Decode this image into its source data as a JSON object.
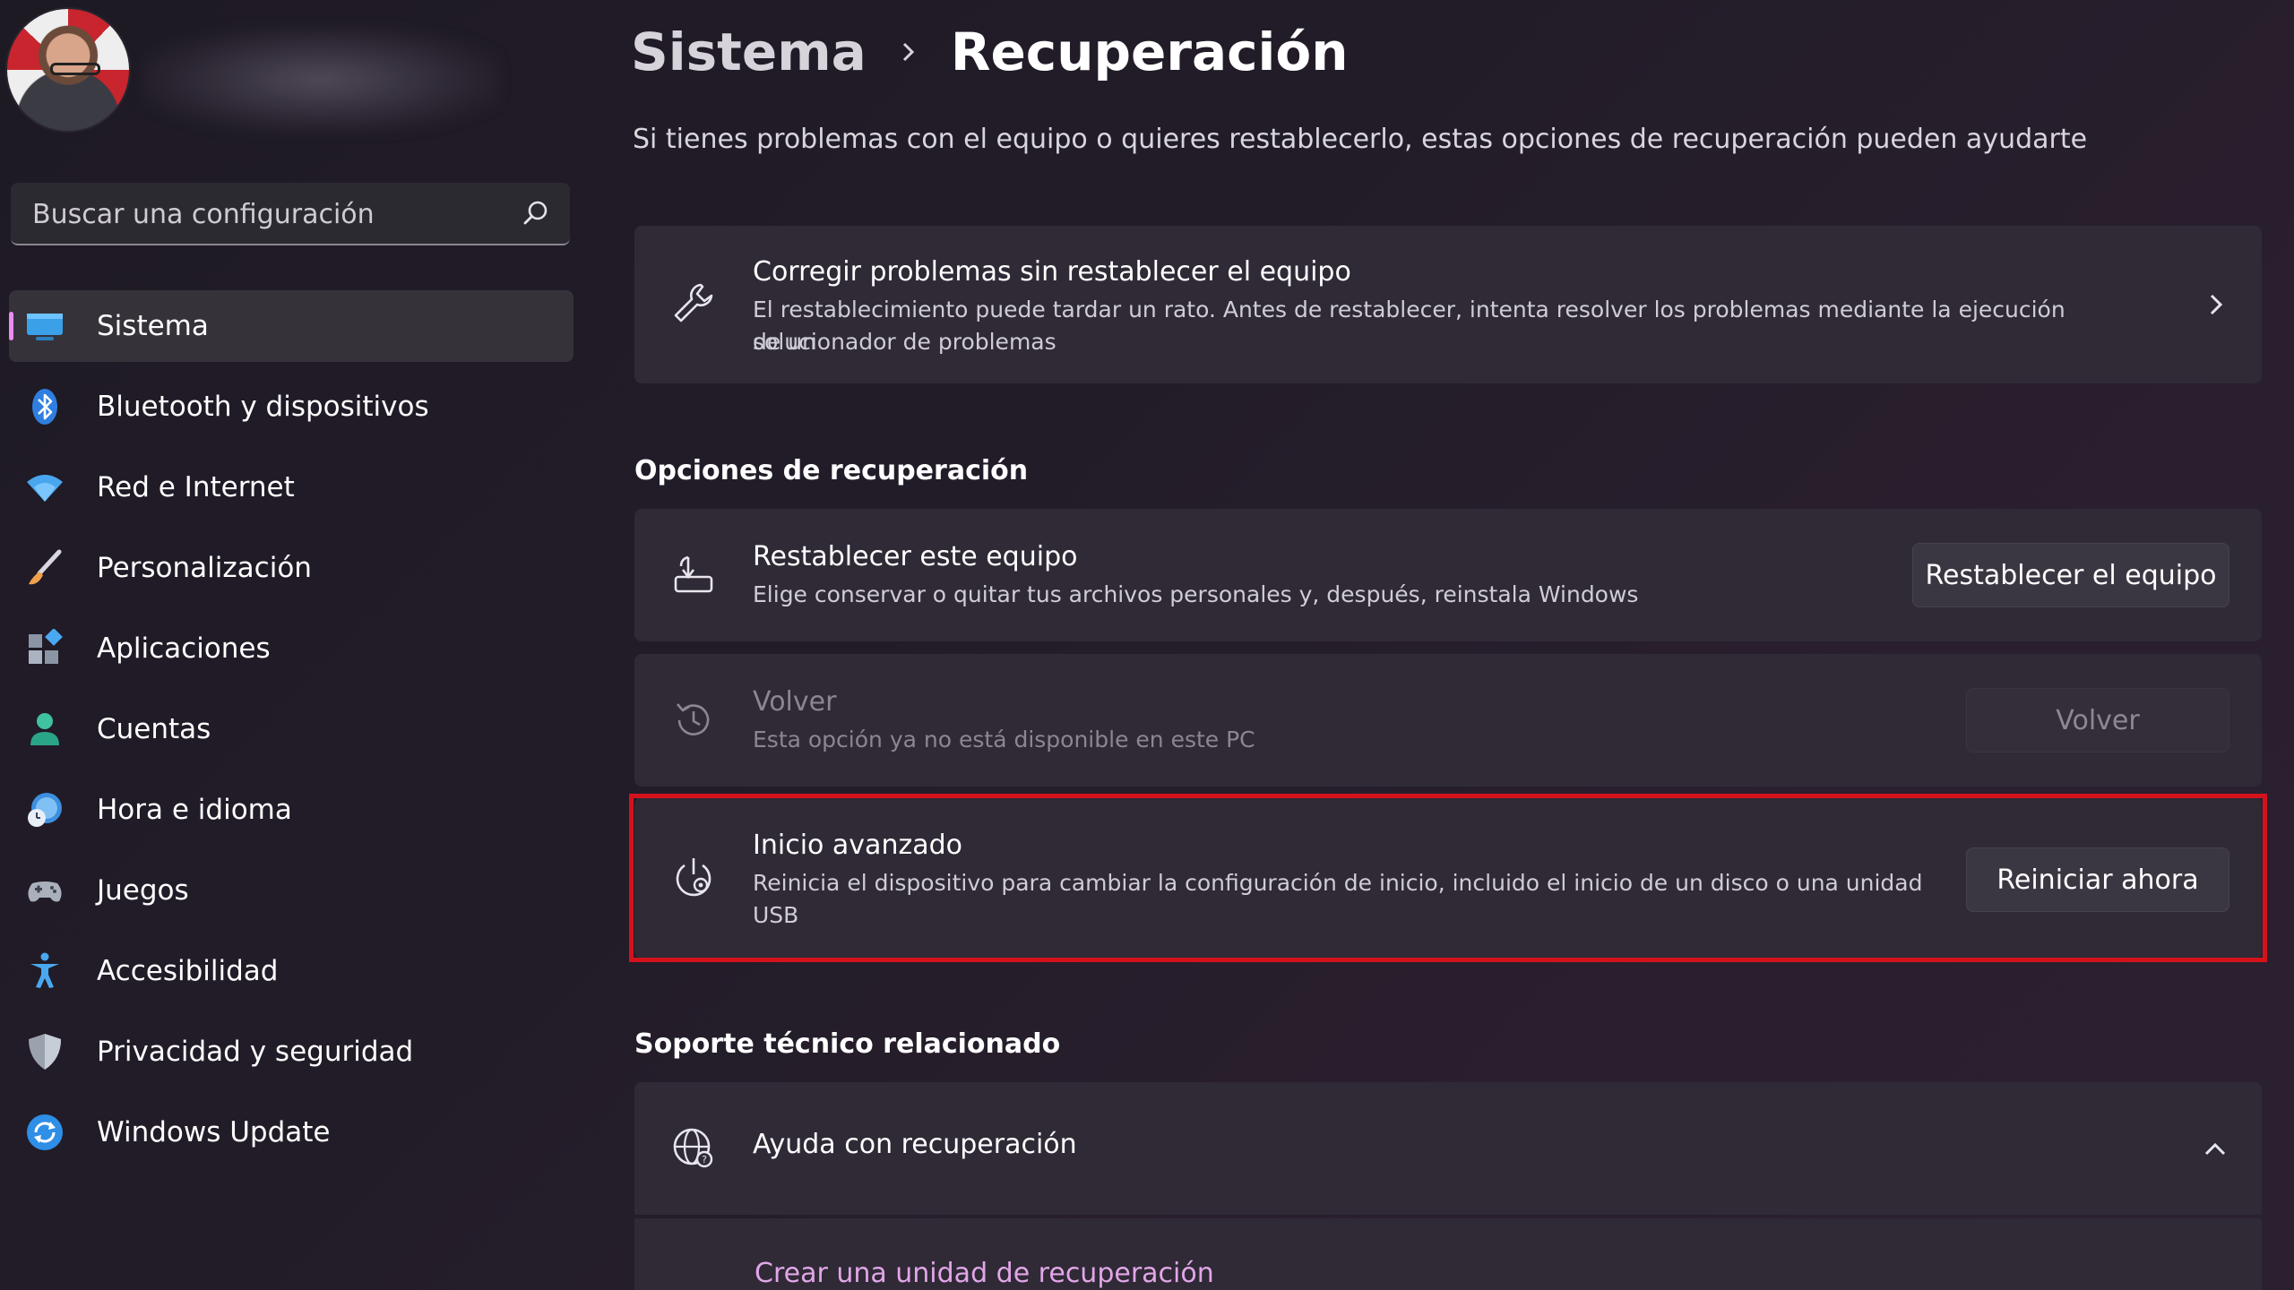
{
  "sidebar": {
    "search_placeholder": "Buscar una configuración",
    "items": [
      {
        "label": "Sistema",
        "icon": "monitor-icon"
      },
      {
        "label": "Bluetooth y dispositivos",
        "icon": "bluetooth-icon"
      },
      {
        "label": "Red e Internet",
        "icon": "wifi-icon"
      },
      {
        "label": "Personalización",
        "icon": "brush-icon"
      },
      {
        "label": "Aplicaciones",
        "icon": "apps-icon"
      },
      {
        "label": "Cuentas",
        "icon": "person-icon"
      },
      {
        "label": "Hora e idioma",
        "icon": "clock-globe-icon"
      },
      {
        "label": "Juegos",
        "icon": "gamepad-icon"
      },
      {
        "label": "Accesibilidad",
        "icon": "accessibility-icon"
      },
      {
        "label": "Privacidad y seguridad",
        "icon": "shield-icon"
      },
      {
        "label": "Windows Update",
        "icon": "update-icon"
      }
    ]
  },
  "header": {
    "parent": "Sistema",
    "current": "Recuperación",
    "subtitle": "Si tienes problemas con el equipo o quieres restablecerlo, estas opciones de recuperación pueden ayudarte"
  },
  "fix_card": {
    "title": "Corregir problemas sin restablecer el equipo",
    "desc_line1": "El restablecimiento puede tardar un rato. Antes de restablecer, intenta resolver los problemas mediante la ejecución de un",
    "desc_line2": "solucionador de problemas"
  },
  "recovery": {
    "heading": "Opciones de recuperación",
    "reset": {
      "title": "Restablecer este equipo",
      "desc": "Elige conservar o quitar tus archivos personales y, después, reinstala Windows",
      "button": "Restablecer el equipo"
    },
    "goback": {
      "title": "Volver",
      "desc": "Esta opción ya no está disponible en este PC",
      "button": "Volver"
    },
    "advanced": {
      "title": "Inicio avanzado",
      "desc_line1": "Reinicia el dispositivo para cambiar la configuración de inicio, incluido el inicio de un disco o una unidad",
      "desc_line2": "USB",
      "button": "Reiniciar ahora"
    }
  },
  "support": {
    "heading": "Soporte técnico relacionado",
    "help_title": "Ayuda con recuperación",
    "link": "Crear una unidad de recuperación"
  },
  "colors": {
    "accent": "#e98df0",
    "highlight_border": "#d4121c",
    "link": "#e2a6e8"
  }
}
